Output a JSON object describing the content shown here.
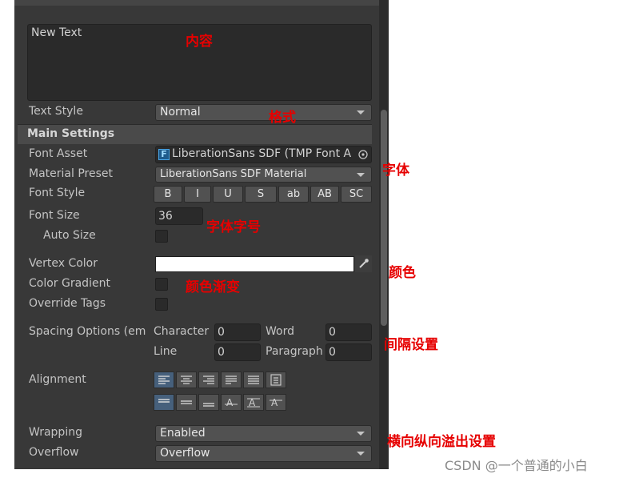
{
  "text_input": {
    "value": "New Text"
  },
  "text_style": {
    "label": "Text Style",
    "value": "Normal"
  },
  "main_settings": {
    "header": "Main Settings"
  },
  "font_asset": {
    "label": "Font Asset",
    "value": "LiberationSans SDF (TMP Font A"
  },
  "material_preset": {
    "label": "Material Preset",
    "value": "LiberationSans SDF Material"
  },
  "font_style": {
    "label": "Font Style",
    "buttons": [
      "B",
      "I",
      "U",
      "S",
      "ab",
      "AB",
      "SC"
    ]
  },
  "font_size": {
    "label": "Font Size",
    "value": "36"
  },
  "auto_size": {
    "label": "Auto Size"
  },
  "vertex_color": {
    "label": "Vertex Color",
    "color": "#ffffff"
  },
  "color_gradient": {
    "label": "Color Gradient"
  },
  "override_tags": {
    "label": "Override Tags"
  },
  "spacing": {
    "label": "Spacing Options (em",
    "character_label": "Character",
    "character_value": "0",
    "word_label": "Word",
    "word_value": "0",
    "line_label": "Line",
    "line_value": "0",
    "paragraph_label": "Paragraph",
    "paragraph_value": "0"
  },
  "alignment": {
    "label": "Alignment"
  },
  "wrapping": {
    "label": "Wrapping",
    "value": "Enabled"
  },
  "overflow": {
    "label": "Overflow",
    "value": "Overflow"
  },
  "annotations": {
    "content": "内容",
    "format": "格式",
    "font": "字体",
    "font_size": "字体字号",
    "color": "颜色",
    "gradient": "颜色渐变",
    "spacing": "间隔设置",
    "overflow": "横向纵向溢出设置"
  },
  "watermark": "CSDN @一个普通的小白",
  "colors": {
    "panel": "#383838",
    "annotation": "#e60000",
    "active_align": "#46607c"
  }
}
